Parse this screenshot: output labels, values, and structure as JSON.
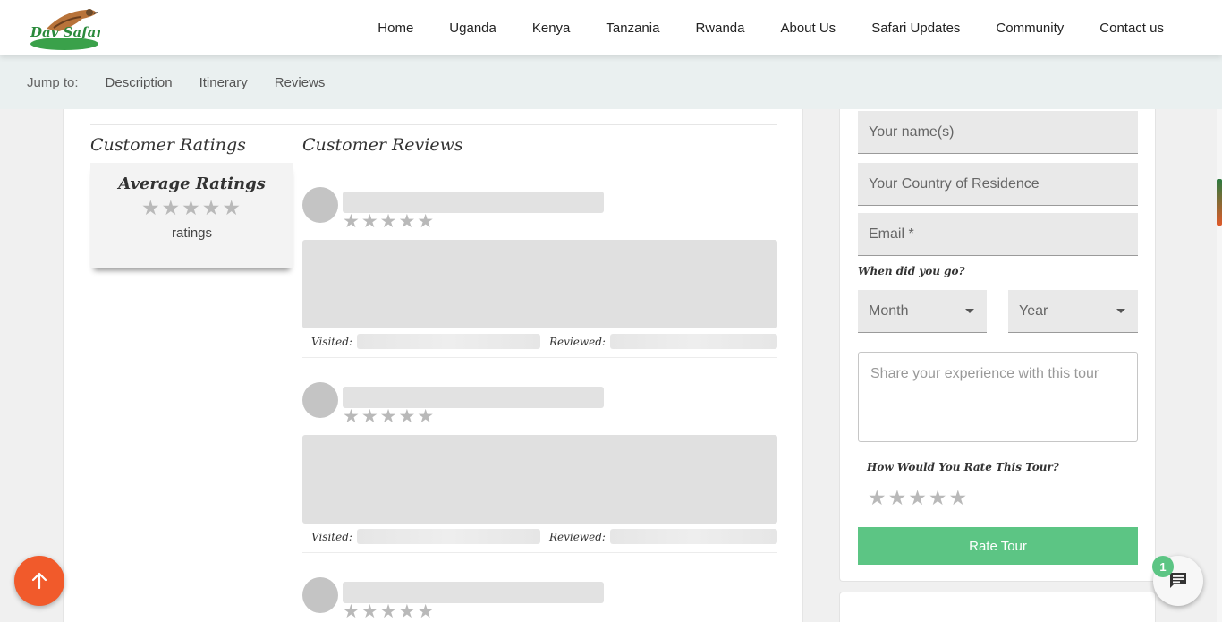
{
  "header": {
    "logo_text": "Dav Safaris",
    "nav": [
      "Home",
      "Uganda",
      "Kenya",
      "Tanzania",
      "Rwanda",
      "About Us",
      "Safari Updates",
      "Community",
      "Contact us"
    ]
  },
  "jumpbar": {
    "label": "Jump to:",
    "links": [
      "Description",
      "Itinerary",
      "Reviews"
    ]
  },
  "ratings": {
    "heading": "Customer Ratings",
    "card_title": "Average Ratings",
    "stars": "★★★★★",
    "subtitle": "ratings"
  },
  "reviews": {
    "heading": "Customer Reviews",
    "stars": "★★★★★",
    "visited_label": "Visited:",
    "reviewed_label": "Reviewed:"
  },
  "form": {
    "name_placeholder": "Your name(s)",
    "country_placeholder": "Your Country of Residence",
    "email_placeholder": "Email *",
    "when_label": "When did you go?",
    "month_placeholder": "Month",
    "year_placeholder": "Year",
    "experience_placeholder": "Share your experience with this tour",
    "rate_label": "How Would You Rate This Tour?",
    "stars": "★★★★★",
    "submit_label": "Rate Tour"
  },
  "chat": {
    "badge_count": "1"
  },
  "colors": {
    "accent_green": "#5cc584",
    "accent_orange": "#f15a2b",
    "star_gray": "#b9b9b9"
  },
  "icons": {
    "scroll_up": "arrow-up-icon",
    "chat": "chat-bubble-icon"
  }
}
